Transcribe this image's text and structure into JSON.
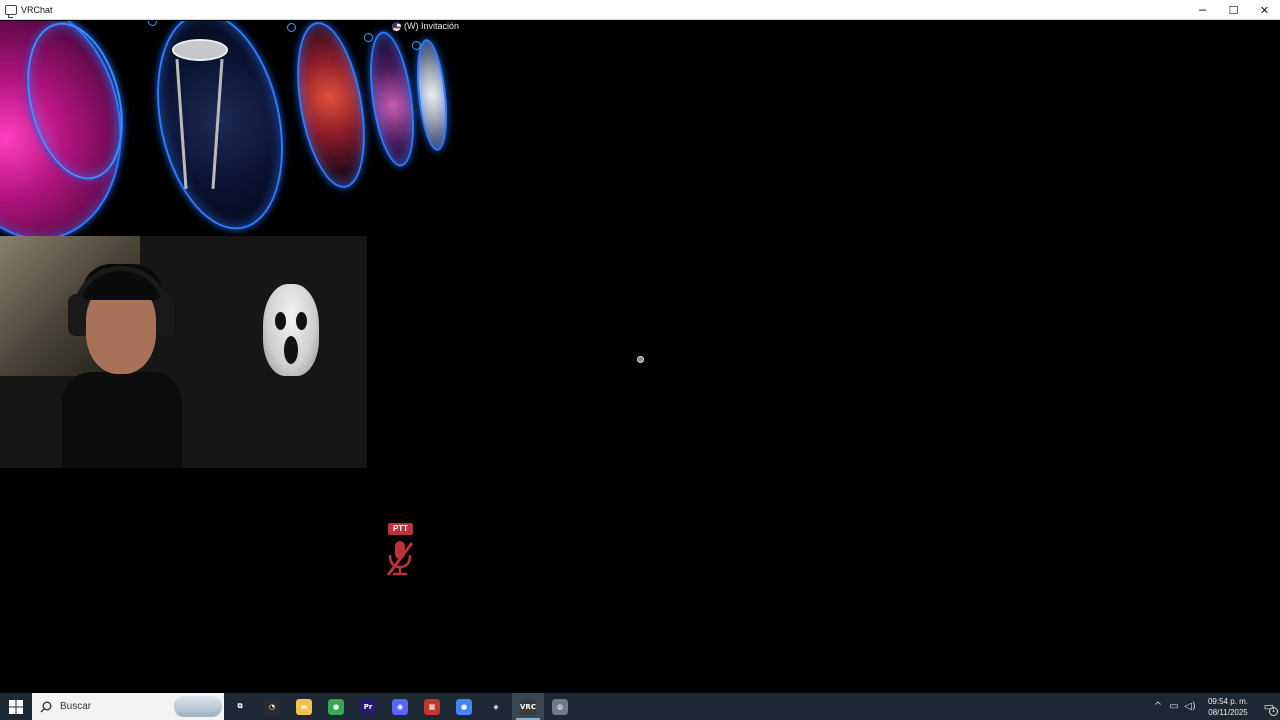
{
  "window": {
    "title": "VRChat",
    "controls": {
      "minimize": "─",
      "maximize": "☐",
      "close": "✕"
    }
  },
  "viewport": {
    "invite": {
      "text": "(W) Invitación"
    },
    "ptt_label": "PTT"
  },
  "taskbar": {
    "search_placeholder": "Buscar",
    "apps": [
      {
        "name": "task-view",
        "glyph": "⧉",
        "color": "#1c2833"
      },
      {
        "name": "clock-app",
        "glyph": "◔",
        "color": "#2b2b2b"
      },
      {
        "name": "file-explorer",
        "glyph": "▬",
        "color": "#f2c14e"
      },
      {
        "name": "chrome-profile",
        "glyph": "●",
        "color": "#34a853"
      },
      {
        "name": "premiere-pro",
        "glyph": "Pr",
        "color": "#2a1a6b"
      },
      {
        "name": "discord",
        "glyph": "◉",
        "color": "#5865f2"
      },
      {
        "name": "media-app",
        "glyph": "▦",
        "color": "#c0392b"
      },
      {
        "name": "chrome",
        "glyph": "●",
        "color": "#4285f4"
      },
      {
        "name": "steam",
        "glyph": "◈",
        "color": "#1b2838"
      },
      {
        "name": "vrchat",
        "glyph": "VRC",
        "color": "#3b3b3b"
      },
      {
        "name": "vr-app",
        "glyph": "◍",
        "color": "#6c7a89"
      }
    ],
    "active_app": "vrchat",
    "tray": {
      "chevron": "^",
      "network": "▭",
      "volume": "◁)",
      "time": "09:54 p. m.",
      "date": "08/11/2025",
      "notifications_count": "1"
    }
  }
}
